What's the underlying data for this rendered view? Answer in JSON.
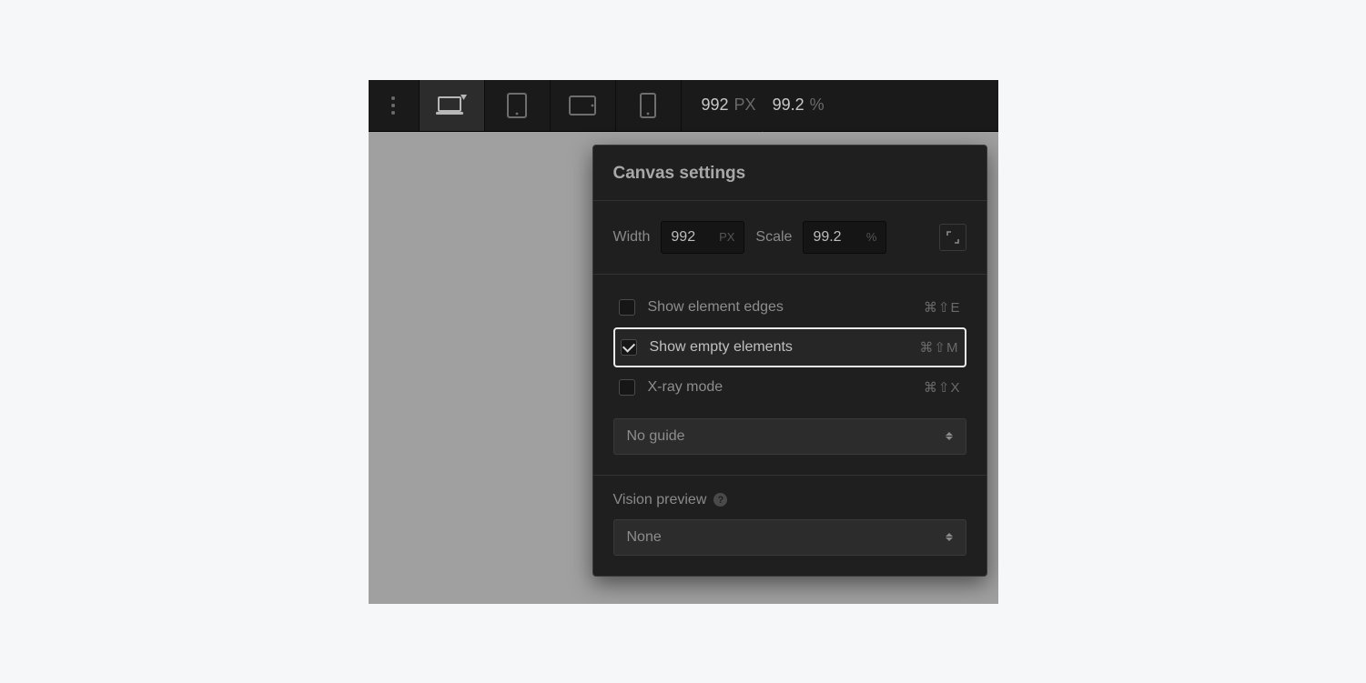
{
  "toolbar": {
    "width_value": "992",
    "width_unit": "PX",
    "scale_value": "99.2",
    "scale_unit": "%"
  },
  "popover": {
    "title": "Canvas settings",
    "width_label": "Width",
    "width_value": "992",
    "width_unit": "PX",
    "scale_label": "Scale",
    "scale_value": "99.2",
    "scale_unit": "%",
    "checks": [
      {
        "label": "Show element edges",
        "shortcut": "⌘⇧E",
        "checked": false,
        "highlight": false
      },
      {
        "label": "Show empty elements",
        "shortcut": "⌘⇧M",
        "checked": true,
        "highlight": true
      },
      {
        "label": "X-ray mode",
        "shortcut": "⌘⇧X",
        "checked": false,
        "highlight": false
      }
    ],
    "guide_select": "No guide",
    "vision_label": "Vision preview",
    "vision_select": "None",
    "help_glyph": "?"
  }
}
